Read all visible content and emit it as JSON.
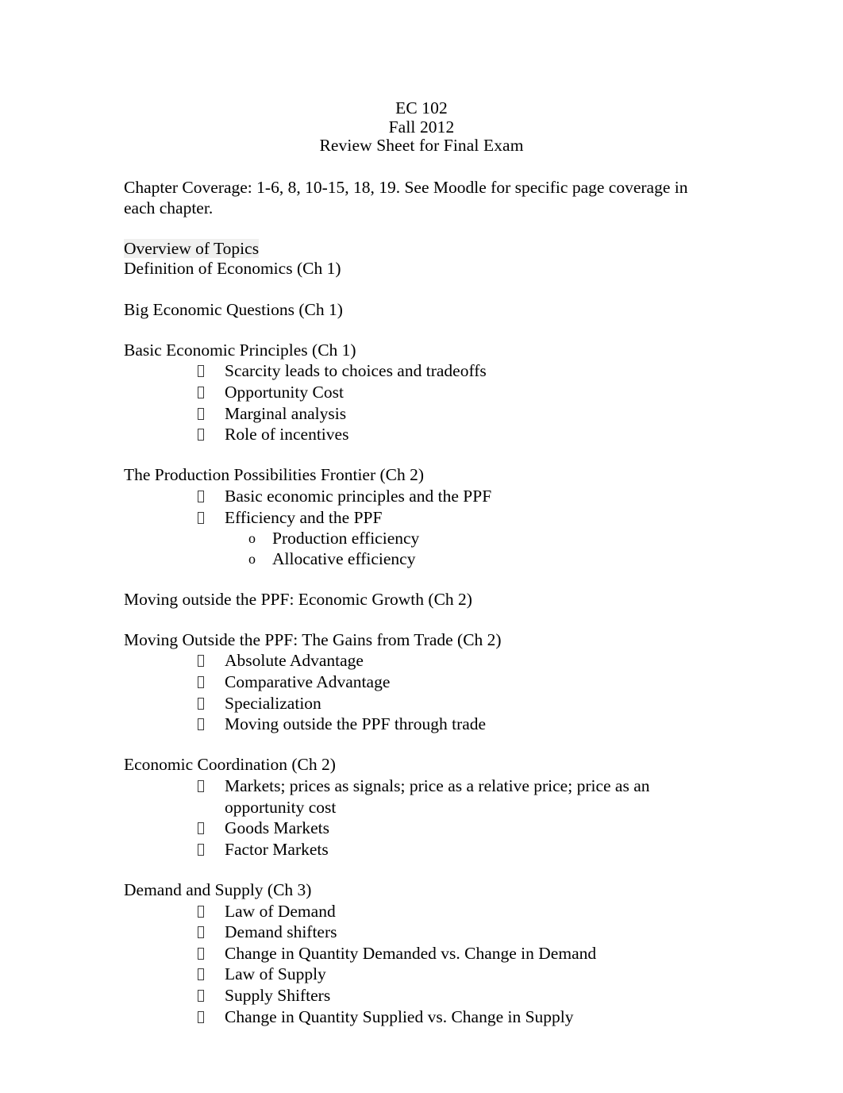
{
  "document": {
    "title_lines": [
      "EC 102",
      "Fall 2012",
      "Review Sheet for Final Exam"
    ],
    "intro_paragraph": "Chapter Coverage: 1-6, 8, 10-15, 18, 19.  See Moodle for specific page coverage in each chapter.",
    "overview_heading": "Overview of Topics",
    "bullet_marker_glyph": "missing-glyph-box",
    "subbullet_marker_glyph": "o",
    "colors": {
      "text": "#000000",
      "page_background": "#ffffff",
      "shading": "#f0f0ef",
      "marker_outline": "#3a3a3a"
    },
    "sections": [
      {
        "heading": "Definition of Economics (Ch 1)",
        "bullets": [],
        "spacer_after": false
      },
      {
        "heading": "Big Economic Questions (Ch 1)",
        "bullets": []
      },
      {
        "heading": "Basic Economic Principles (Ch 1)",
        "bullets": [
          {
            "text": "Scarcity leads to choices and tradeoffs",
            "sub": []
          },
          {
            "text": "Opportunity Cost",
            "sub": []
          },
          {
            "text": "Marginal analysis",
            "sub": []
          },
          {
            "text": "Role of incentives",
            "sub": []
          }
        ]
      },
      {
        "heading": "The Production Possibilities Frontier (Ch 2)",
        "bullets": [
          {
            "text": "Basic economic principles and the PPF",
            "sub": []
          },
          {
            "text": "Efficiency and the PPF",
            "sub": [
              "Production efficiency",
              "Allocative efficiency"
            ]
          }
        ]
      },
      {
        "heading": "Moving outside the PPF: Economic Growth (Ch 2)",
        "bullets": []
      },
      {
        "heading": "Moving Outside the PPF: The Gains from Trade (Ch 2)",
        "bullets": [
          {
            "text": "Absolute Advantage",
            "sub": []
          },
          {
            "text": "Comparative Advantage",
            "sub": []
          },
          {
            "text": "Specialization",
            "sub": []
          },
          {
            "text": "Moving outside the PPF through trade",
            "sub": []
          }
        ]
      },
      {
        "heading": "Economic Coordination (Ch 2)",
        "bullets": [
          {
            "text": "Markets; prices as signals; price as a relative price; price as an opportunity cost",
            "sub": []
          },
          {
            "text": "Goods Markets",
            "sub": []
          },
          {
            "text": "Factor Markets",
            "sub": []
          }
        ]
      },
      {
        "heading": "Demand and Supply (Ch 3)",
        "bullets": [
          {
            "text": "Law of Demand",
            "sub": []
          },
          {
            "text": "Demand shifters",
            "sub": []
          },
          {
            "text": "Change in Quantity Demanded vs. Change in Demand",
            "sub": []
          },
          {
            "text": "Law of Supply",
            "sub": []
          },
          {
            "text": "Supply Shifters",
            "sub": []
          },
          {
            "text": "Change in Quantity Supplied vs. Change in Supply",
            "sub": []
          }
        ]
      }
    ]
  }
}
